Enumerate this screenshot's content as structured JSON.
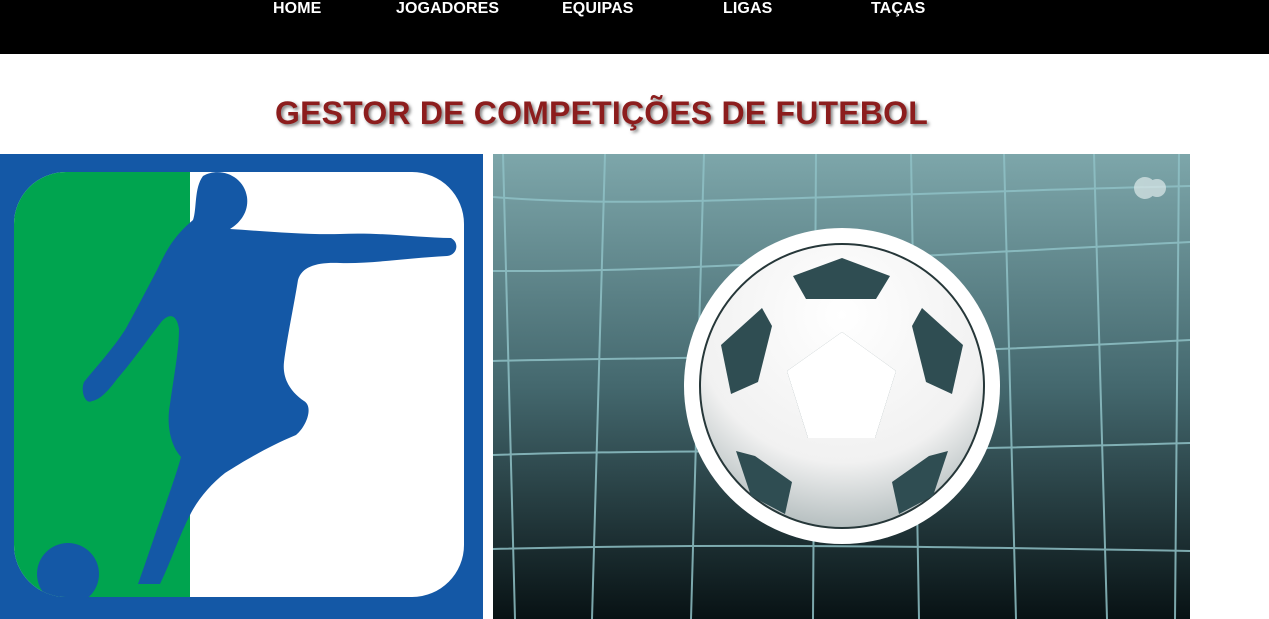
{
  "nav": {
    "items": [
      {
        "label": "HOME"
      },
      {
        "label": "JOGADORES"
      },
      {
        "label": "EQUIPAS"
      },
      {
        "label": "LIGAS"
      },
      {
        "label": "TAÇAS"
      }
    ]
  },
  "main": {
    "title": "GESTOR DE COMPETIÇÕES DE FUTEBOL"
  },
  "images": [
    {
      "name": "soccer-player-logo-image"
    },
    {
      "name": "soccer-ball-net-image"
    }
  ],
  "colors": {
    "nav_background": "#000000",
    "title": "#8c1d1d",
    "logo_blue": "#1458a6",
    "logo_green": "#00a44f"
  }
}
